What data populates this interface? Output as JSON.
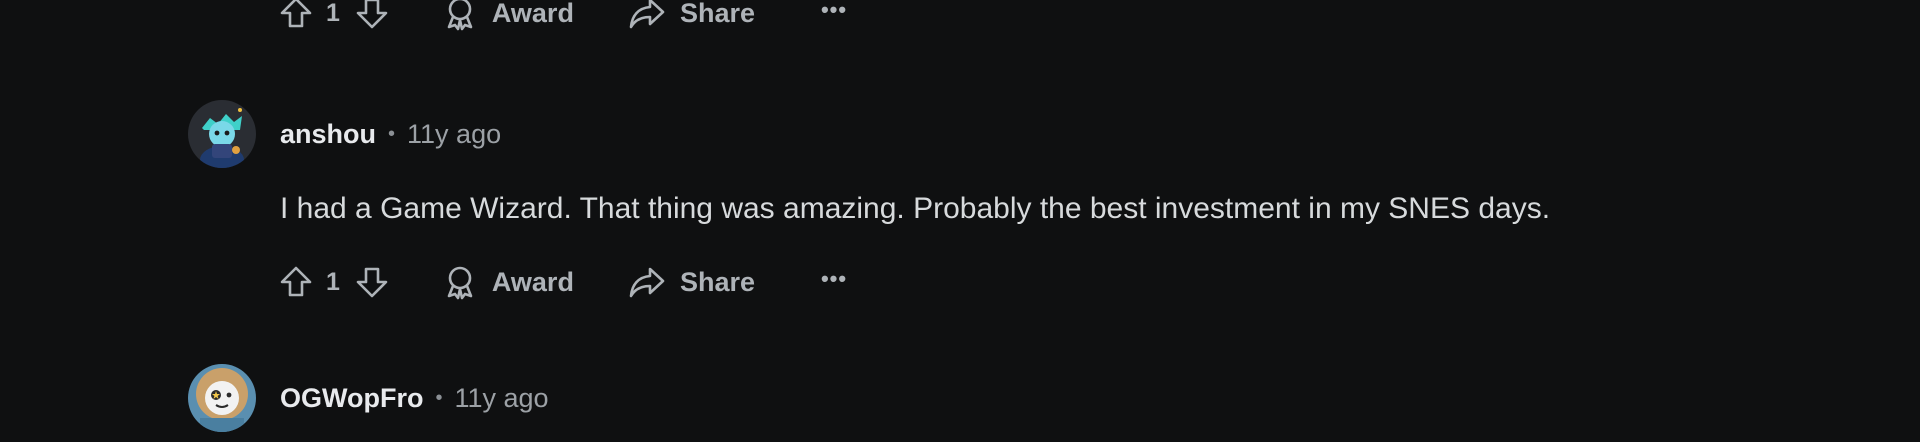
{
  "comments": [
    {
      "votes": "1",
      "award_label": "Award",
      "share_label": "Share",
      "more_label": "•••"
    },
    {
      "username": "anshou",
      "separator": "•",
      "age": "11y ago",
      "body": "I had a Game Wizard. That thing was amazing. Probably the best investment in my SNES days.",
      "votes": "1",
      "award_label": "Award",
      "share_label": "Share",
      "more_label": "•••"
    },
    {
      "username": "OGWopFro",
      "separator": "•",
      "age": "11y ago"
    }
  ],
  "icons": {
    "upvote": "upvote-arrow-icon",
    "downvote": "downvote-arrow-icon",
    "award": "award-ribbon-icon",
    "share": "share-arrow-icon"
  },
  "colors": {
    "background": "#0f1011",
    "action_text": "#aeb3b8",
    "username": "#e8eaed",
    "body_text": "#d7dadc"
  }
}
